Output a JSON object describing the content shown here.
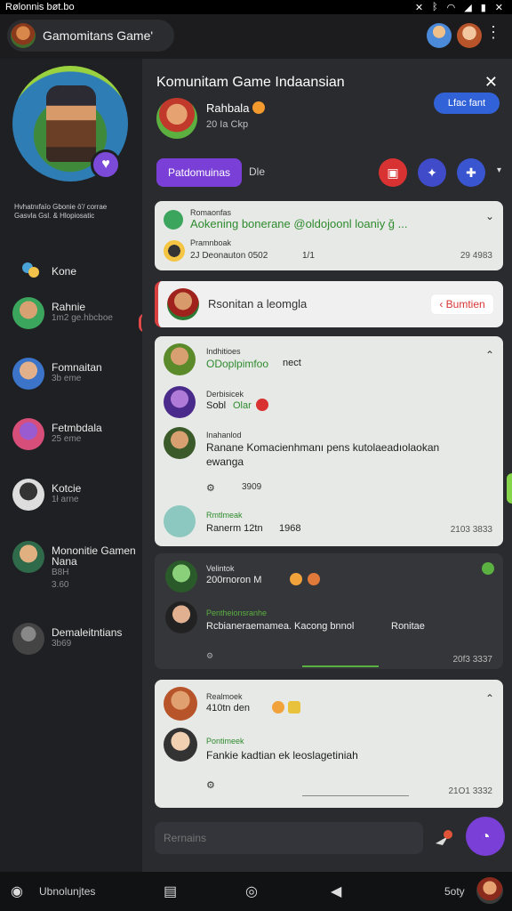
{
  "status_bar": {
    "time": "Rølonnis bøt.bo",
    "icons": [
      "mute-icon",
      "bluetooth-icon",
      "wifi-icon",
      "signal-icon",
      "battery-icon",
      "close-icon"
    ]
  },
  "topbar": {
    "server_name": "Gamomitans Game'",
    "more": "⋮"
  },
  "sidebar": {
    "bio": "Hvhatnıfaīo Gbonie ō'/ corrae Gasvla Gsl. & Hlopiosatic",
    "home_label": "Kone",
    "items": [
      {
        "name": "Rahnie",
        "sub": "1m2 ge.hbcboe",
        "color": "#3ba55d"
      },
      {
        "name": "Fomnaitan",
        "sub": "3b eme",
        "color": "#3b74c8"
      },
      {
        "name": "Fetmbdala",
        "sub": "25 eme",
        "color": "#d84e7a"
      },
      {
        "name": "Kotcie",
        "sub": "1ł arne",
        "color": "#555"
      },
      {
        "name": "Mononitie Gamen",
        "name2": "Nana",
        "sub": "B8H",
        "sub2": "3.60",
        "color": "#2f6a4a"
      },
      {
        "name": "Demaleitntians",
        "sub": "3b69",
        "color": "#666"
      }
    ]
  },
  "main": {
    "title": "Komunitam Game Indaansian",
    "join_label": "Lfac fant",
    "host": {
      "name": "Rahbala",
      "meta": "20 Ia Ckp"
    },
    "follow_label": "Patdomuinas",
    "follow_extra": "Dle",
    "chevron": "▾"
  },
  "pinned": {
    "label": "Romaonfas",
    "text": "Aokening bonerane @oldojoonl loaniy ğ ...",
    "author": "Pramnboak",
    "detail": "2J Deonauton 0502",
    "count": "1/1",
    "time": "29 4983",
    "chevron": "⌄"
  },
  "banner": {
    "label": "Rsonitan a leomgla",
    "button": "Bumtien"
  },
  "card1": {
    "msgs": [
      {
        "author": "Indhitioes",
        "text": "ODoplpimfoo",
        "extra": "nect"
      },
      {
        "author": "Derbisicek",
        "text": "Sobl",
        "extra": "Olar"
      },
      {
        "author": "Inahanlod",
        "text": "Ranane Komacienhmanı pens kutolaeadıolaokan",
        "text2": "ewanga"
      }
    ],
    "reactions": "3909",
    "footer": {
      "author": "Rmtlmeak",
      "text": "Ranerm 12tn",
      "count": "1968",
      "time": "2103 3833"
    }
  },
  "card2": {
    "author1": "Velintok",
    "text1": "200rnoron M",
    "author2": "Pentheionsranhe",
    "text2": "Rcbianeraemamea. Kacong bnnol",
    "extra2": "Ronitae",
    "time": "20f3 3337"
  },
  "card3": {
    "author1": "Realmoek",
    "text1": "410tn den",
    "author2": "Pontimeek",
    "text2": "Fankie kadtian ek leoslagetiniah",
    "time": "21O1 3332"
  },
  "composer": {
    "placeholder": "Rernains"
  },
  "bottomnav": {
    "label": "Ubnolunjtes",
    "right_label": "5oty"
  }
}
